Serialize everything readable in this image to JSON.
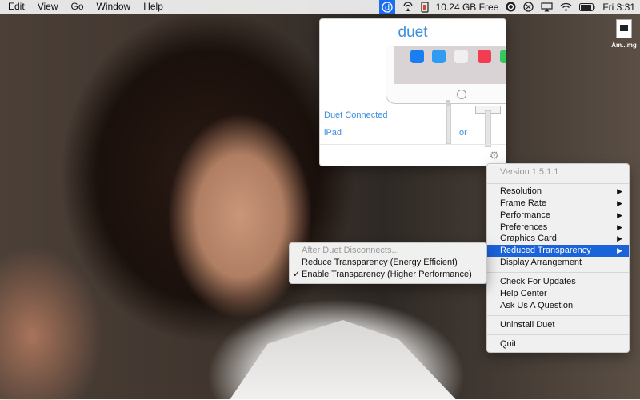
{
  "menubar": {
    "items": [
      "Edit",
      "View",
      "Go",
      "Window",
      "Help"
    ],
    "free_space": "10.24 GB Free",
    "clock": "Fri 3:31"
  },
  "desktop": {
    "file_label": "Am...mg"
  },
  "popover": {
    "brand": "duet",
    "status": "Duet Connected",
    "device": "iPad",
    "or_label": "or",
    "app_colors": [
      "#1a7ef0",
      "#2f9bf2",
      "#f0f0f0",
      "#f23c52",
      "#34c759"
    ]
  },
  "context_menu": {
    "version": "Version 1.5.1.1",
    "items": [
      {
        "label": "Resolution"
      },
      {
        "label": "Frame Rate"
      },
      {
        "label": "Performance"
      },
      {
        "label": "Preferences"
      },
      {
        "label": "Graphics Card"
      },
      {
        "label": "Reduced Transparency"
      },
      {
        "label": "Display Arrangement"
      },
      {
        "label": "Check For Updates"
      },
      {
        "label": "Help Center"
      },
      {
        "label": "Ask Us A Question"
      },
      {
        "label": "Uninstall Duet"
      },
      {
        "label": "Quit"
      }
    ]
  },
  "submenu": {
    "header": "After Duet Disconnects...",
    "items": [
      {
        "label": "Reduce Transparency (Energy Efficient)",
        "checked": false
      },
      {
        "label": "Enable Transparency (Higher Performance)",
        "checked": true
      }
    ],
    "check_mark": "✓"
  }
}
